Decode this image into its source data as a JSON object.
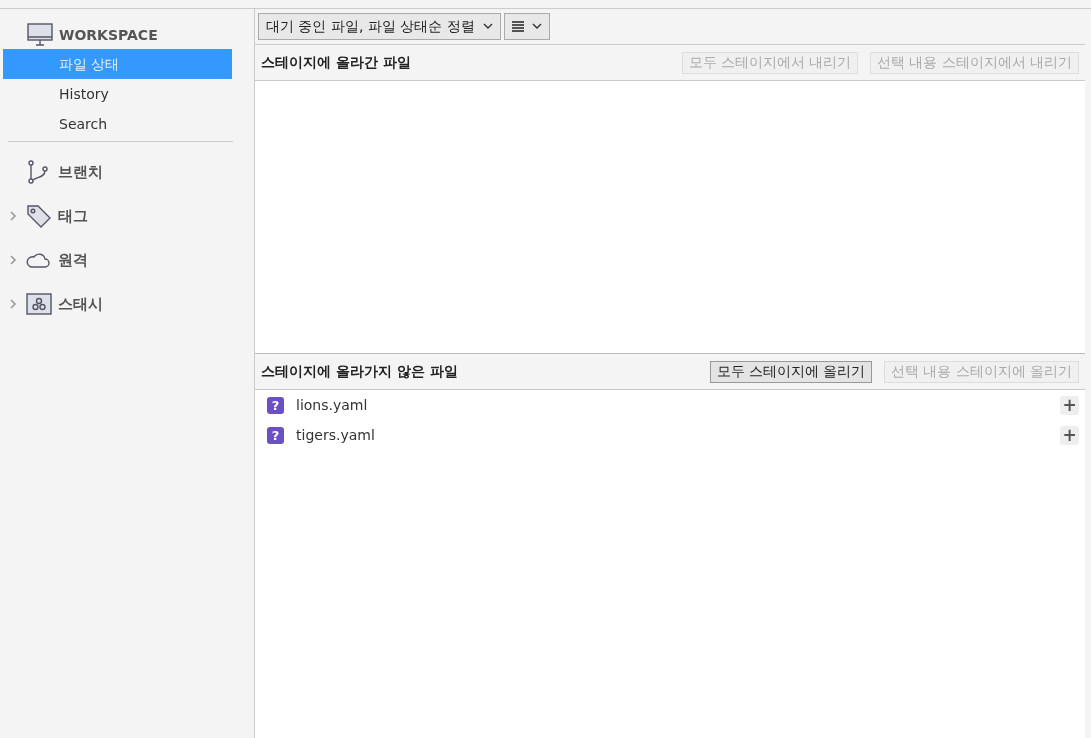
{
  "sidebar": {
    "workspace": {
      "title": "WORKSPACE",
      "items": [
        {
          "label": "파일 상태",
          "selected": true
        },
        {
          "label": "History",
          "selected": false
        },
        {
          "label": "Search",
          "selected": false
        }
      ]
    },
    "sections": [
      {
        "kind": "branch",
        "label": "브랜치"
      },
      {
        "kind": "tag",
        "label": "태그",
        "expanded": false
      },
      {
        "kind": "remote",
        "label": "원격",
        "expanded": false
      },
      {
        "kind": "stash",
        "label": "스태시",
        "expanded": false
      }
    ]
  },
  "toolbar": {
    "filter": "대기 중인 파일, 파일 상태순 정렬"
  },
  "staged": {
    "title": "스테이지에 올라간 파일",
    "buttons": [
      {
        "label": "모두 스테이지에서 내리기",
        "disabled": true
      },
      {
        "label": "선택 내용 스테이지에서 내리기",
        "disabled": true
      }
    ]
  },
  "unstaged": {
    "title": "스테이지에 올라가지 않은 파일",
    "buttons": [
      {
        "label": "모두 스테이지에 올리기",
        "disabled": false
      },
      {
        "label": "선택 내용 스테이지에 올리기",
        "disabled": true
      }
    ],
    "files": [
      {
        "status": "?",
        "name": "lions.yaml",
        "action": "+"
      },
      {
        "status": "?",
        "name": "tigers.yaml",
        "action": "+"
      }
    ]
  }
}
